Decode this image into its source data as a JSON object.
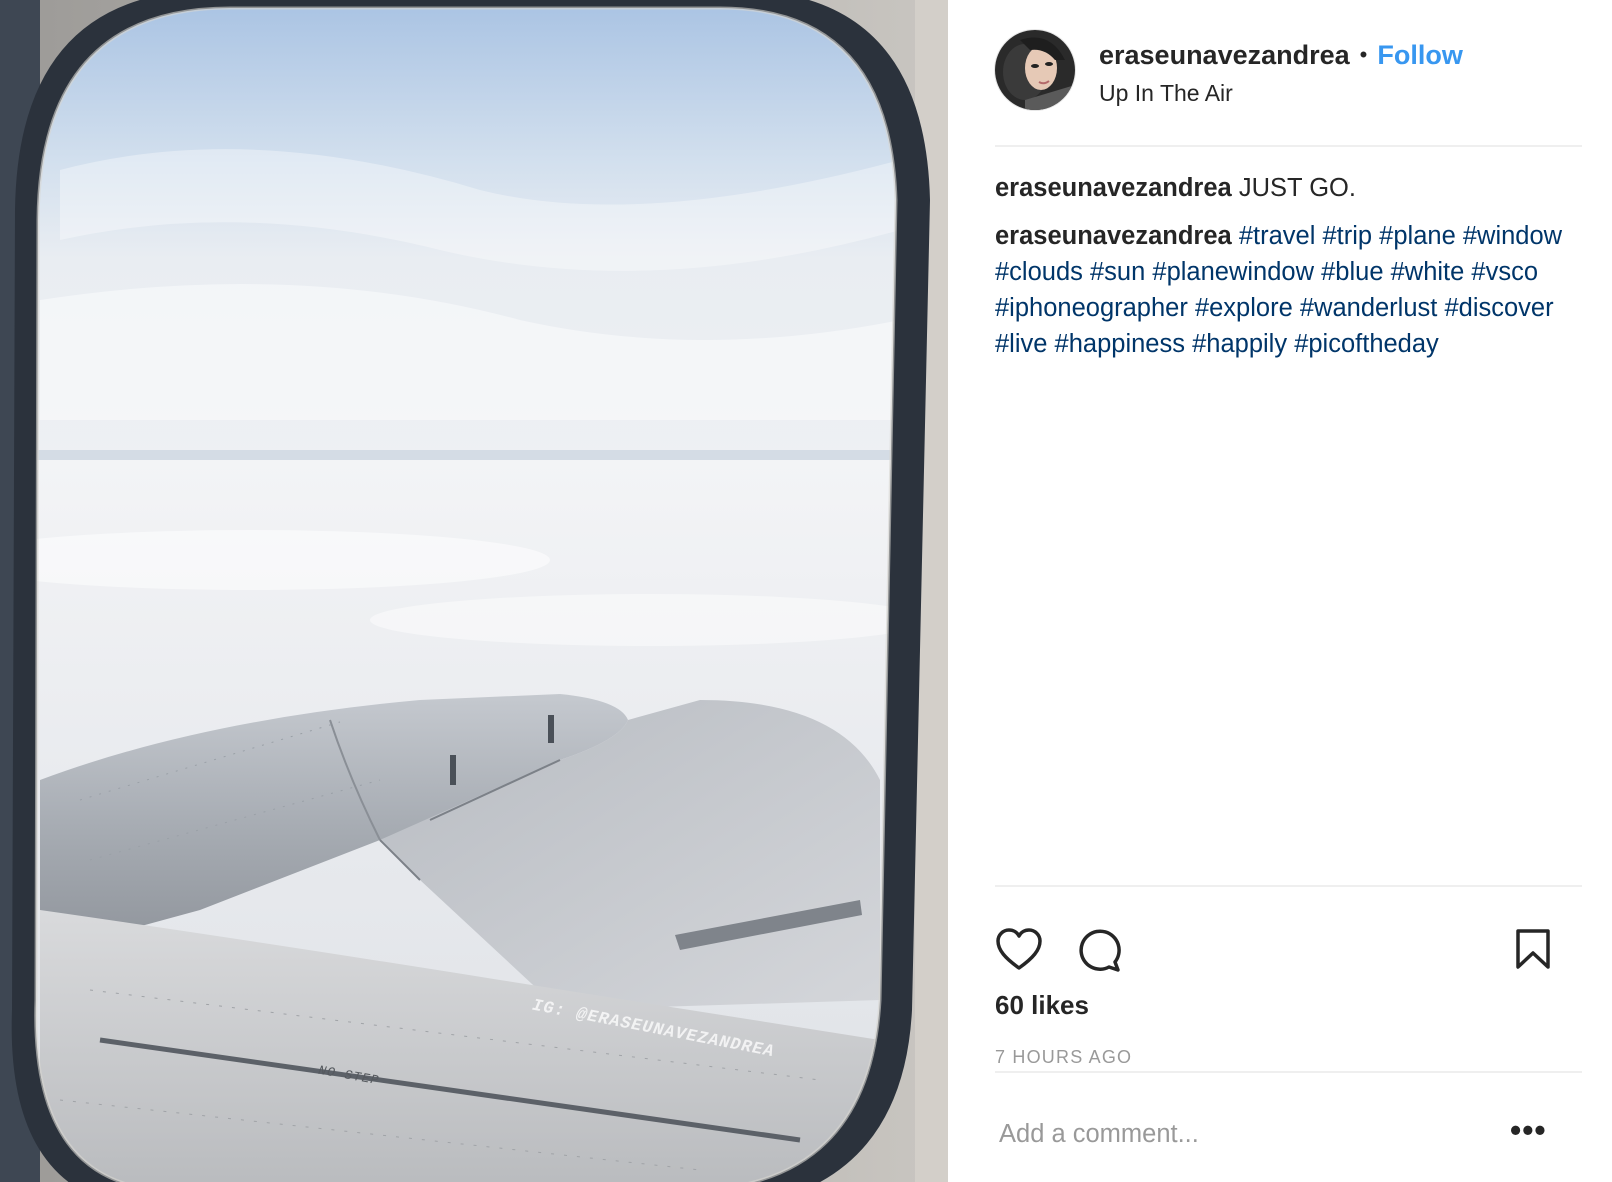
{
  "post": {
    "username": "eraseunavezandrea",
    "separator": "•",
    "follow_label": "Follow",
    "location": "Up In The Air",
    "caption": {
      "username": "eraseunavezandrea",
      "text": "JUST GO."
    },
    "comment": {
      "username": "eraseunavezandrea",
      "hashtags": [
        "#travel",
        "#trip",
        "#plane",
        "#window",
        "#clouds",
        "#sun",
        "#planewindow",
        "#blue",
        "#white",
        "#vsco",
        "#iphoneographer",
        "#explore",
        "#wanderlust",
        "#discover",
        "#live",
        "#happiness",
        "#happily",
        "#picoftheday"
      ]
    },
    "likes": "60 likes",
    "timestamp": "7 HOURS AGO",
    "comment_placeholder": "Add a comment...",
    "more_label": "•••"
  },
  "photo": {
    "watermark": "IG: @ERASEUNAVEZANDREA",
    "wing_marking": "NO STEP"
  },
  "icons": [
    "heart-icon",
    "comment-icon",
    "bookmark-icon",
    "more-options-icon"
  ],
  "colors": {
    "follow": "#3897f0",
    "hashtag": "#003569",
    "muted": "#999999",
    "divider": "#efefef"
  }
}
